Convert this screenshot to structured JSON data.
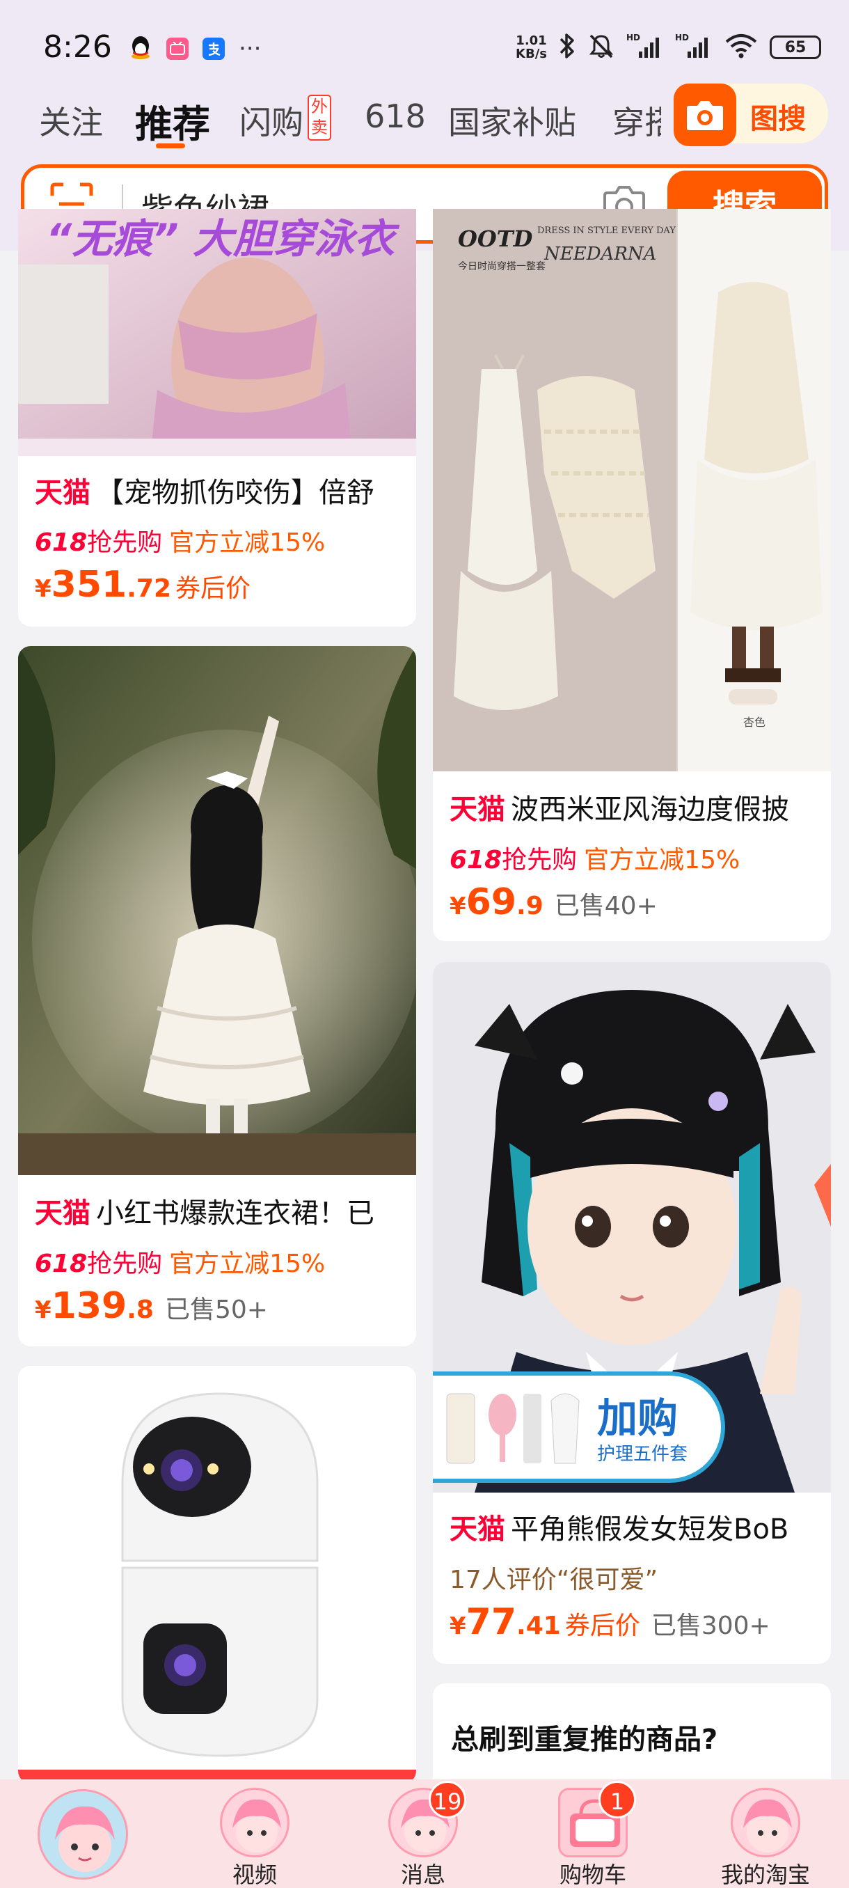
{
  "status_bar": {
    "time": "8:26",
    "net_speed_value": "1.01",
    "net_speed_unit": "KB/s",
    "battery": "65",
    "more": "···"
  },
  "tabs": [
    {
      "label": "关注"
    },
    {
      "label": "推荐"
    },
    {
      "label": "闪购"
    },
    {
      "label": "618"
    },
    {
      "label": "国家补贴"
    },
    {
      "label": "穿搭"
    }
  ],
  "waimai_badge": "外卖",
  "tusou_label": "图搜",
  "search": {
    "query": "紫色纱裙",
    "button": "搜索"
  },
  "colors": {
    "accent": "#ff5a00",
    "tmall": "#ff0036"
  },
  "products": [
    {
      "shop": "天猫",
      "title": "【宠物抓伤咬伤】倍舒",
      "promo_618": "618",
      "promo_tag": "抢先购",
      "promo_desc": "官方立减15%",
      "price_int": "351",
      "price_dec": ".72",
      "price_note": "券后价",
      "banner_text": "“无痕” 大胆穿泳衣"
    },
    {
      "shop": "天猫",
      "title": "波西米亚风海边度假披",
      "promo_618": "618",
      "promo_tag": "抢先购",
      "promo_desc": "官方立减15%",
      "price_int": "69",
      "price_dec": ".9",
      "sold": "已售40+",
      "img_brand": "OOTD",
      "img_sub": "DRESS IN STYLE EVERY DAY",
      "img_sub2": "今日时尚穿搭一整套",
      "img_brand2": "NEEDARNA",
      "img_color": "杏色"
    },
    {
      "shop": "天猫",
      "title": "小红书爆款连衣裙！已",
      "promo_618": "618",
      "promo_tag": "抢先购",
      "promo_desc": "官方立减15%",
      "price_int": "139",
      "price_dec": ".8",
      "sold": "已售50+"
    },
    {
      "shop": "天猫",
      "title": "平角熊假发女短发BoB",
      "review": "17人评价“很可爱”",
      "price_int": "77",
      "price_dec": ".41",
      "price_note": "券后价",
      "sold": "已售300+",
      "overlay_title": "加购",
      "overlay_sub": "护理五件套"
    }
  ],
  "feedback_card": {
    "title": "总刷到重复推的商品?"
  },
  "bottom_nav": [
    {
      "label": ""
    },
    {
      "label": "视频"
    },
    {
      "label": "消息",
      "badge": "19"
    },
    {
      "label": "购物车",
      "badge": "1"
    },
    {
      "label": "我的淘宝"
    }
  ]
}
